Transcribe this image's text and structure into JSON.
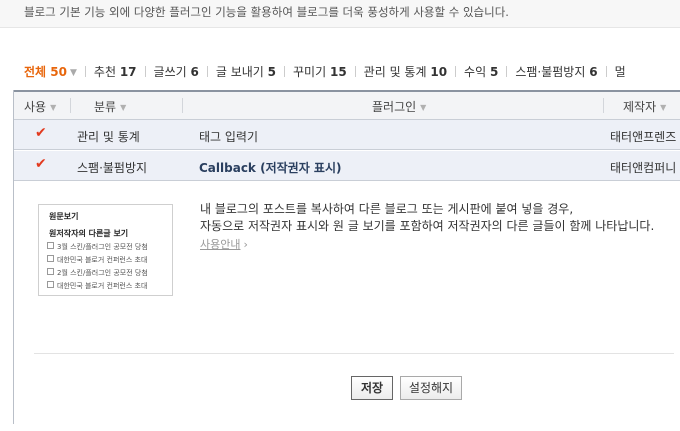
{
  "intro_text": "블로그 기본 기능 외에 다양한 플러그인 기능을 활용하여 블로그를 더욱 풍성하게 사용할 수 있습니다.",
  "tabs": [
    {
      "label": "전체",
      "count": "50",
      "active": true
    },
    {
      "label": "추천",
      "count": "17"
    },
    {
      "label": "글쓰기",
      "count": "6"
    },
    {
      "label": "글 보내기",
      "count": "5"
    },
    {
      "label": "꾸미기",
      "count": "15"
    },
    {
      "label": "관리 및 통계",
      "count": "10"
    },
    {
      "label": "수익",
      "count": "5"
    },
    {
      "label": "스팸·불펌방지",
      "count": "6"
    },
    {
      "label": "멀"
    }
  ],
  "columns": {
    "use": "사용",
    "category": "분류",
    "plugin": "플러그인",
    "maker": "제작자"
  },
  "rows": [
    {
      "category": "관리 및 통계",
      "name": "태그 입력기",
      "maker": "태터앤프렌즈"
    },
    {
      "category": "스팸·불펌방지",
      "name": "Callback (저작권자 표시)",
      "maker": "태터앤컴퍼니"
    }
  ],
  "thumbnail": {
    "title": "원문보기",
    "subtitle": "원저작자의 다른글 보기",
    "items": [
      "3월 스킨/플러그인 공모전 당첨",
      "대한민국 블로거 컨퍼런스 초대",
      "2월 스킨/플러그인 공모전 당첨",
      "대한민국 블로거 컨퍼런스 초대"
    ]
  },
  "description": {
    "line1": "내 블로그의 포스트를 복사하여 다른 블로그 또는 게시판에 붙여 넣을 경우,",
    "line2": "자동으로 저작권자 표시와 원 글 보기를 포함하여 저작권자의 다른 글들이 함께 나타납니다.",
    "usage_link": "사용안내"
  },
  "buttons": {
    "save": "저장",
    "cancel": "설정해지"
  },
  "colors": {
    "accent": "#e8660c",
    "check": "#e23a1f",
    "row_highlight": "#edf0f7"
  }
}
